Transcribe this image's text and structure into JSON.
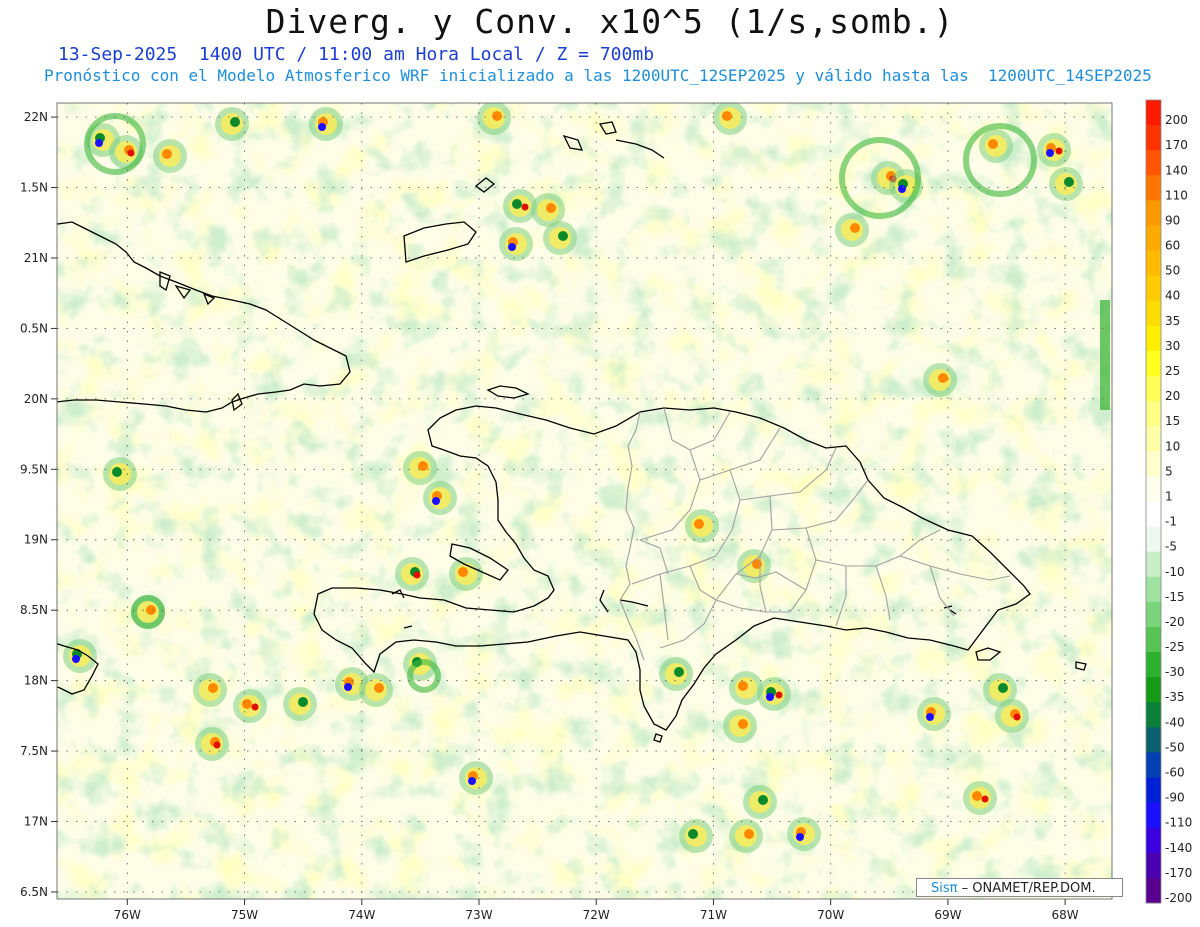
{
  "title": "Diverg. y Conv. x10^5 (1/s,somb.)",
  "subtitle_line1": "13-Sep-2025  1400 UTC / 11:00 am Hora Local / Z = 700mb",
  "subtitle_line2": "Pronóstico con el Modelo Atmosferico WRF inicializado a las 1200UTC_12SEP2025 y válido hasta las  1200UTC_14SEP2025",
  "credit": {
    "logo": "Sisπ",
    "text": " – ONAMET/REP.DOM."
  },
  "map": {
    "lat_labels": [
      "22N",
      "1.5N",
      "21N",
      "0.5N",
      "20N",
      "9.5N",
      "19N",
      "8.5N",
      "18N",
      "7.5N",
      "17N",
      "6.5N"
    ],
    "lon_labels": [
      "76W",
      "75W",
      "74W",
      "73W",
      "72W",
      "71W",
      "70W",
      "69W",
      "68W"
    ],
    "lat_values": [
      22,
      21.5,
      21,
      20.5,
      20,
      19.5,
      19,
      18.5,
      18,
      17.5,
      17,
      16.5
    ],
    "lon_values": [
      -76,
      -75,
      -74,
      -73,
      -72,
      -71,
      -70,
      -69,
      -68
    ],
    "extent": {
      "west": -76.6,
      "east": -67.6,
      "south": 16.45,
      "north": 22.1
    }
  },
  "legend": {
    "labels": [
      "200",
      "170",
      "140",
      "110",
      "90",
      "60",
      "50",
      "40",
      "35",
      "30",
      "25",
      "20",
      "15",
      "10",
      "5",
      "1",
      "-1",
      "-5",
      "-10",
      "-15",
      "-20",
      "-25",
      "-30",
      "-35",
      "-40",
      "-50",
      "-60",
      "-90",
      "-110",
      "-140",
      "-170",
      "-200"
    ],
    "colors": [
      "#ff1a00",
      "#ff3300",
      "#ff5500",
      "#ff7700",
      "#ff9900",
      "#ffaa00",
      "#ffbb00",
      "#ffcc00",
      "#ffdd00",
      "#ffee00",
      "#ffff20",
      "#ffff55",
      "#ffff88",
      "#ffffaa",
      "#ffffcc",
      "#ffffee",
      "#ffffff",
      "#eef8ee",
      "#c8eec8",
      "#a0e2a0",
      "#7ad47a",
      "#55c455",
      "#2db02d",
      "#149a14",
      "#0a7f3a",
      "#0a6070",
      "#0040b0",
      "#0020d8",
      "#1a10ff",
      "#3a00e0",
      "#4a00b0",
      "#5a0090"
    ]
  },
  "colors": {
    "coast": "#000000",
    "borders": "#a0a0a0",
    "grid": "#666666",
    "field_pos": "#ffff99",
    "field_neg": "#b8e6b8"
  }
}
